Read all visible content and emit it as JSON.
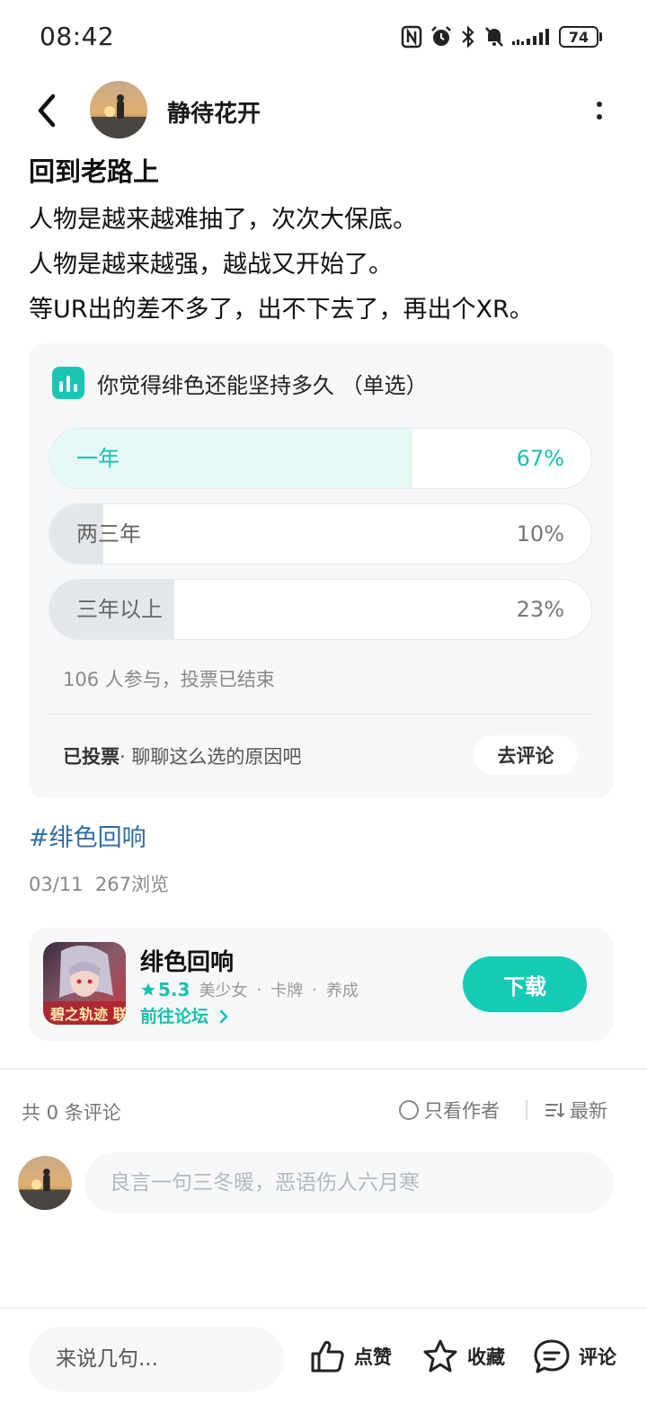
{
  "status_bar": {
    "time": "08:42",
    "battery": "74"
  },
  "header": {
    "author_name": "静待花开"
  },
  "post": {
    "title": "回到老路上",
    "lines": [
      "人物是越来越难抽了，次次大保底。",
      "人物是越来越强，越战又开始了。",
      "等UR出的差不多了，出不下去了，再出个XR。"
    ]
  },
  "poll": {
    "question": "你觉得绯色还能坚持多久 （单选）",
    "options": [
      {
        "label": "一年",
        "percent_text": "67%",
        "percent": 67,
        "selected": true
      },
      {
        "label": "两三年",
        "percent_text": "10%",
        "percent": 10,
        "selected": false
      },
      {
        "label": "三年以上",
        "percent_text": "23%",
        "percent": 23,
        "selected": false
      }
    ],
    "participants": "106 人参与，投票已结束",
    "voted_label": "已投票",
    "voted_prompt": "· 聊聊这么选的原因吧",
    "comment_button": "去评论"
  },
  "topic_tag": "#绯色回响",
  "post_meta": {
    "date": "03/11",
    "views": "267浏览"
  },
  "game": {
    "name": "绯色回响",
    "rating": "5.3",
    "tags": [
      "美少女",
      "·",
      "卡牌",
      "·",
      "养成"
    ],
    "forum_link": "前往论坛",
    "download_button": "下载",
    "icon_caption": "碧之轨迹 联动"
  },
  "comments": {
    "count_text": "共 0 条评论",
    "author_only": "只看作者",
    "sort": "最新",
    "input_placeholder": "良言一句三冬暖，恶语伤人六月寒"
  },
  "bottom_bar": {
    "reply_placeholder": "来说几句...",
    "like": "点赞",
    "favorite": "收藏",
    "comment": "评论"
  },
  "colors": {
    "accent": "#16cbb6",
    "link": "#2f6ea3",
    "card_bg": "#f5f7f8",
    "selected_fill": "#e6f8f6",
    "unselected_fill": "#e4e7ea"
  }
}
